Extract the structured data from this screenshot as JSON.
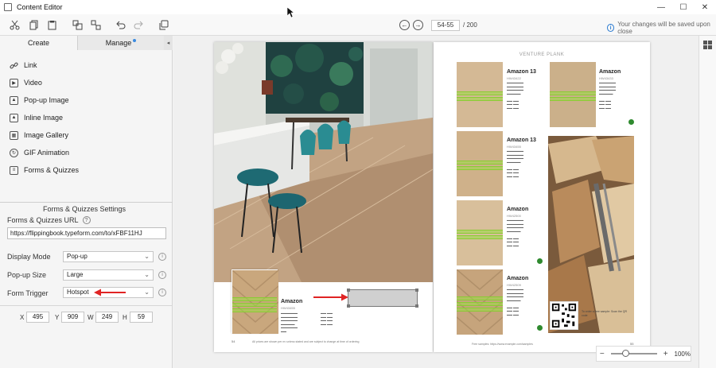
{
  "window": {
    "title": "Content Editor",
    "controls": [
      "—",
      "☐",
      "✕"
    ]
  },
  "toolbar": {
    "page_input": "54-55",
    "page_total": "/ 200",
    "save_note": "Your changes will be saved upon close"
  },
  "panel": {
    "tabs": [
      {
        "label": "Create"
      },
      {
        "label": "Manage"
      }
    ],
    "menu": [
      {
        "label": "Link",
        "icon": "link-icon"
      },
      {
        "label": "Video",
        "icon": "video-icon"
      },
      {
        "label": "Pop-up Image",
        "icon": "popup-image-icon"
      },
      {
        "label": "Inline Image",
        "icon": "inline-image-icon"
      },
      {
        "label": "Image Gallery",
        "icon": "image-gallery-icon"
      },
      {
        "label": "GIF Animation",
        "icon": "gif-icon"
      },
      {
        "label": "Forms & Quizzes",
        "icon": "forms-icon"
      }
    ],
    "settings": {
      "title": "Forms & Quizzes Settings",
      "url_label": "Forms & Quizzes URL",
      "url_value": "https://flippingbook.typeform.com/to/xFBF11HJ",
      "display_mode_label": "Display Mode",
      "display_mode_value": "Pop-up",
      "popup_size_label": "Pop-up Size",
      "popup_size_value": "Large",
      "form_trigger_label": "Form Trigger",
      "form_trigger_value": "Hotspot"
    },
    "coords": {
      "x_label": "X",
      "x": "495",
      "y_label": "Y",
      "y": "909",
      "w_label": "W",
      "w": "249",
      "h_label": "H",
      "h": "59"
    }
  },
  "left_page": {
    "product_name": "Amazon",
    "product_code": "HW43455",
    "footer": "All prices are shown per m² unless stated and are subject to change at time of ordering",
    "page_number": "54"
  },
  "right_page": {
    "title": "VENTURE PLANK",
    "products": [
      {
        "name": "Amazon 13",
        "code": "HW43422"
      },
      {
        "name": "Amazon",
        "code": "HW43433"
      },
      {
        "name": "Amazon 13",
        "code": "HW43455"
      },
      {
        "name": "Amazon",
        "code": "HW42500"
      },
      {
        "name": "Amazon",
        "code": "HW42509"
      }
    ],
    "qr_text": "To order a free sample: Scan the QR code",
    "footer": "Free samples: https://www.example.com/samples",
    "page_number": "55"
  },
  "zoom": {
    "value": "100%"
  },
  "colors": {
    "accent": "#2d7cd1",
    "hotspot_green": "#8acc34",
    "arrow_red": "#e02424"
  }
}
